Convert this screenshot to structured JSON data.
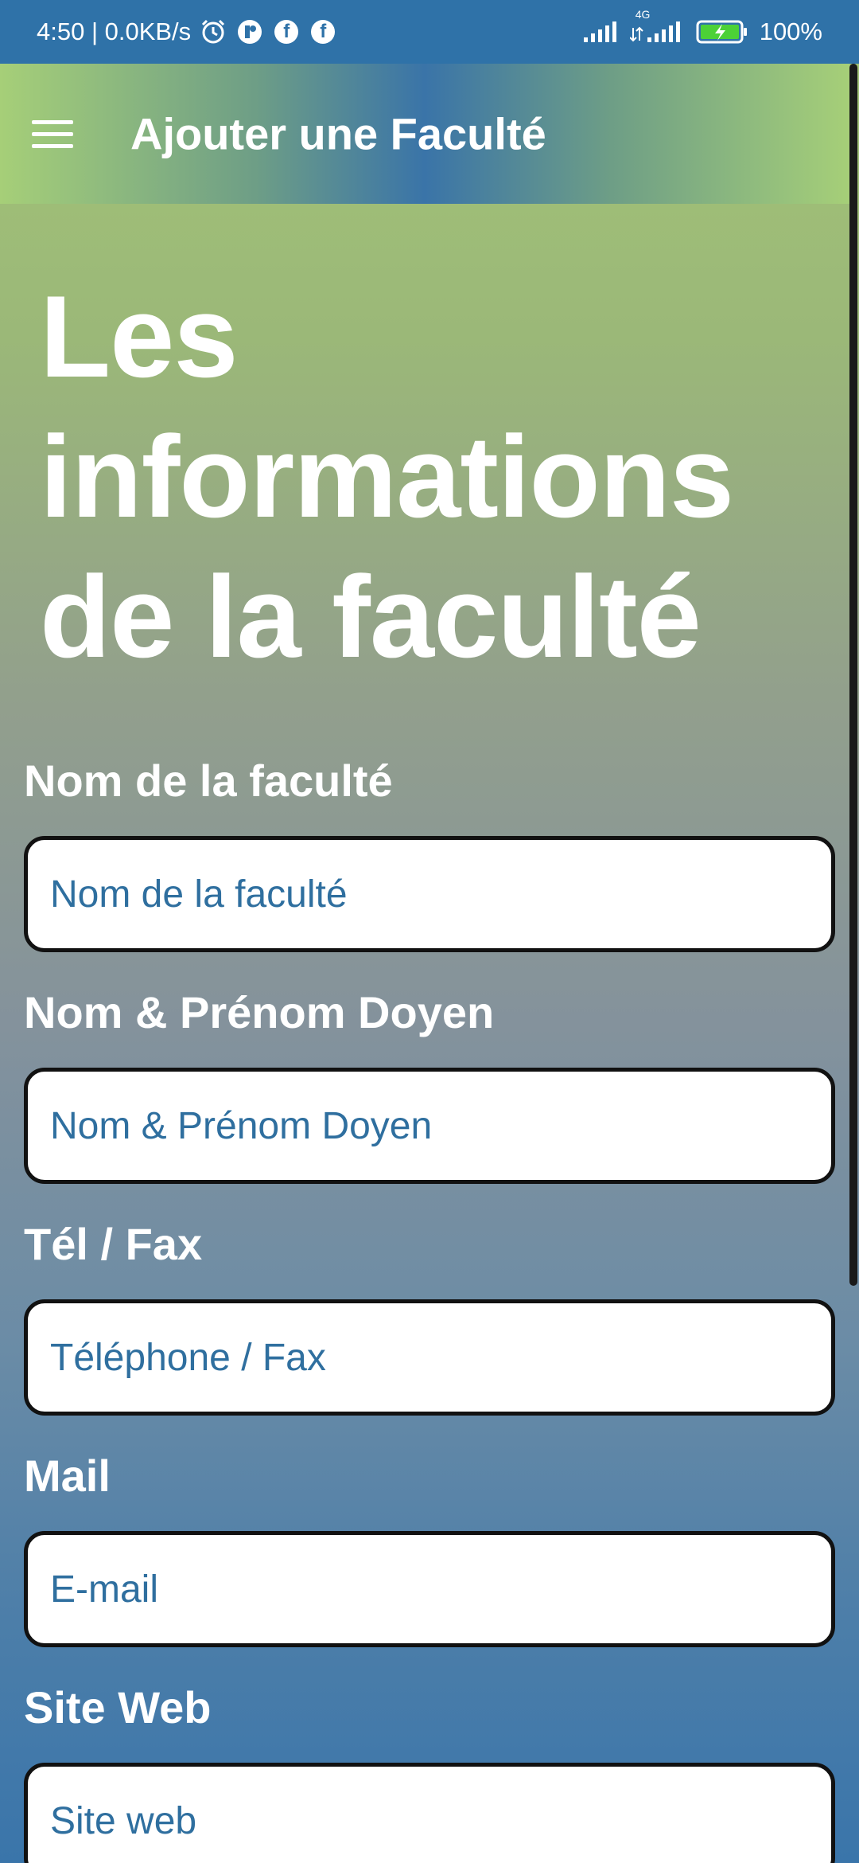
{
  "status_bar": {
    "time_speed": "4:50 | 0.0KB/s",
    "network_label": "4G",
    "battery": "100%",
    "icons": [
      "alarm-icon",
      "app-icon",
      "facebook-icon",
      "facebook-icon",
      "signal-icon",
      "signal-4g-icon",
      "battery-charging-icon"
    ]
  },
  "app_bar": {
    "title": "Ajouter une Faculté",
    "menu_icon": "hamburger-menu-icon"
  },
  "heading": "Les informations de la faculté",
  "form": {
    "fields": [
      {
        "label": "Nom de la faculté",
        "placeholder": "Nom de la faculté",
        "value": ""
      },
      {
        "label": "Nom & Prénom Doyen",
        "placeholder": "Nom & Prénom Doyen",
        "value": ""
      },
      {
        "label": "Tél / Fax",
        "placeholder": "Téléphone / Fax",
        "value": ""
      },
      {
        "label": "Mail",
        "placeholder": "E-mail",
        "value": ""
      },
      {
        "label": "Site Web",
        "placeholder": "Site web",
        "value": ""
      }
    ]
  },
  "colors": {
    "status_bar": "#2f72a8",
    "accent_blue": "#3a74a8",
    "accent_green": "#a6cf78",
    "input_text": "#2f6f9f"
  }
}
